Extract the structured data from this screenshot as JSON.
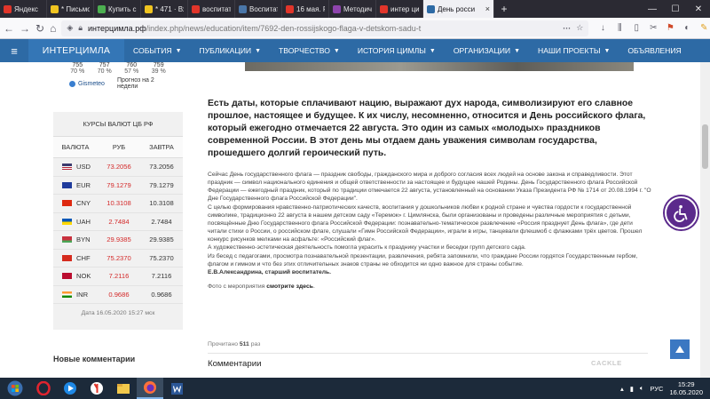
{
  "browser": {
    "tabs": [
      {
        "title": "Яндекс",
        "color": "#e1352a"
      },
      {
        "title": "* Письмо «Го",
        "color": "#f0c420"
      },
      {
        "title": "Купить соко",
        "color": "#4caf50"
      },
      {
        "title": "* 471 · Входящ",
        "color": "#f0c420"
      },
      {
        "title": "воспитател",
        "color": "#e1352a"
      },
      {
        "title": "Воспитате",
        "color": "#4a76a8"
      },
      {
        "title": "16 мая. РП",
        "color": "#e1352a"
      },
      {
        "title": "Методическ",
        "color": "#8e44ad"
      },
      {
        "title": "интер цимл",
        "color": "#e1352a"
      }
    ],
    "active_tab": {
      "title": "День росси",
      "close": "×",
      "color": "#2d6aa5"
    },
    "new_tab": "+",
    "url_domain": "интерцимла.рф",
    "url_path": "/index.php/news/education/item/7692-den-rossijskogo-flaga-v-detskom-sadu-t"
  },
  "site": {
    "brand": "ИНТЕРЦИМЛА",
    "menu": [
      {
        "label": "СОБЫТИЯ",
        "caret": "▼"
      },
      {
        "label": "ПУБЛИКАЦИИ",
        "caret": "▼"
      },
      {
        "label": "ТВОРЧЕСТВО",
        "caret": "▼"
      },
      {
        "label": "ИСТОРИЯ ЦИМЛЫ",
        "caret": "▼"
      },
      {
        "label": "ОРГАНИЗАЦИИ",
        "caret": "▼"
      },
      {
        "label": "НАШИ ПРОЕКТЫ",
        "caret": "▼"
      },
      {
        "label": "ОБЪЯВЛЕНИЯ",
        "caret": ""
      }
    ]
  },
  "weather": {
    "row1": [
      "755",
      "757",
      "760",
      "759"
    ],
    "row2": [
      "70 %",
      "70 %",
      "57 %",
      "39 %"
    ],
    "provider": "Gismeteo",
    "forecast_label": "Прогноз на 2 недели"
  },
  "rates": {
    "title": "КУРСЫ ВАЛЮТ ЦБ РФ",
    "headers": [
      "ВАЛЮТА",
      "РУБ",
      "ЗАВТРА"
    ],
    "rows": [
      {
        "code": "USD",
        "today": "73.2056",
        "tomorrow": "73.2056",
        "flag": "us"
      },
      {
        "code": "EUR",
        "today": "79.1279",
        "tomorrow": "79.1279",
        "flag": "eu"
      },
      {
        "code": "CNY",
        "today": "10.3108",
        "tomorrow": "10.3108",
        "flag": "cn"
      },
      {
        "code": "UAH",
        "today": "2.7484",
        "tomorrow": "2.7484",
        "flag": "ua"
      },
      {
        "code": "BYN",
        "today": "29.9385",
        "tomorrow": "29.9385",
        "flag": "by"
      },
      {
        "code": "CHF",
        "today": "75.2370",
        "tomorrow": "75.2370",
        "flag": "ch"
      },
      {
        "code": "NOK",
        "today": "7.2116",
        "tomorrow": "7.2116",
        "flag": "no"
      },
      {
        "code": "INR",
        "today": "0.9686",
        "tomorrow": "0.9686",
        "flag": "in"
      }
    ],
    "date": "Дата 16.05.2020 15:27 мск"
  },
  "sidebar": {
    "new_comments": "Новые комментарии"
  },
  "article": {
    "lead": "Есть даты, которые сплачивают нацию, выражают дух народа, символизируют его славное прошлое, настоящее и будущее. К их числу, несомненно, относится и День российского флага, который ежегодно отмечается 22 августа. Это один из самых «молодых» праздников современной России. В этот день мы отдаем дань уважения символам государства, прошедшего долгий героический путь.",
    "paragraphs": [
      "Сейчас День государственного флага — праздник свободы, гражданского мира и доброго согласия всех людей на основе закона и справедливости. Этот праздник — символ национального единения и общей ответственности за настоящее и будущее нашей Родины. День Государственного флага Российской Федерации — ежегодный праздник, который по традиции отмечается 22 августа, установленный на основании Указа Президента РФ № 1714 от 20.08.1994 г. \"О Дне Государственного флага Российской Федерации\".",
      "С целью формирования нравственно-патриотических качеств, воспитания у дошкольников любви к родной стране и чувства гордости к государственной символике, традиционно 22 августа в нашем детском саду «Теремок» г. Цимлянска, были организованы и проведены различные мероприятия с детьми, посвящённые Дню Государственного флага Российской Федерации: познавательно-тематическое развлечение «Россия празднует День флага», где дети читали стихи о России, о российском флаге, слушали «Гимн Российской Федерации», играли в игры, танцевали флешмоб с флажками трёх цветов. Прошел конкурс рисунков мелками на асфальте: «Российский флаг».",
      "А художественно-эстетическая деятельность помогла украсить к празднику участки и беседки групп детского сада.",
      "Из бесед с педагогами, просмотра познавательной презентации, развлечения, ребята запомнили, что граждане России гордятся Государственным гербом, флагом и гимном и что без этих отличительных знаков страны не обходится ни одно важное для страны событие."
    ],
    "signature": "Е.В.Александрина, старший воспитатель.",
    "photos_prefix": "Фото с мероприятия",
    "photos_link": "смотрите здесь",
    "photos_suffix": ".",
    "views_prefix": "Прочитано",
    "views_count": "511",
    "views_suffix": "раз",
    "comments_title": "Комментарии",
    "cackle": "CACKLE"
  },
  "taskbar": {
    "lang": "РУС",
    "time": "15:29",
    "date": "16.05.2020"
  }
}
